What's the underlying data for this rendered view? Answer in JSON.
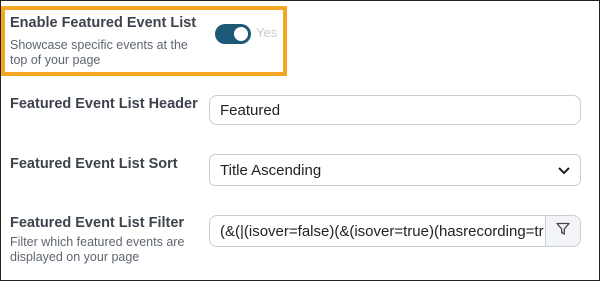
{
  "featured_toggle": {
    "label": "Enable Featured Event List",
    "description": "Showcase specific events at the top of your page",
    "state_text": "Yes",
    "enabled": true
  },
  "header_field": {
    "label": "Featured Event List Header",
    "value": "Featured"
  },
  "sort_field": {
    "label": "Featured Event List Sort",
    "value": "Title Ascending"
  },
  "filter_field": {
    "label": "Featured Event List Filter",
    "description": "Filter which featured events are displayed on your page",
    "value": "(&(|(isover=false)(&(isover=true)(hasrecording=tr"
  },
  "colors": {
    "highlight": "#f5a623",
    "toggle_on": "#1d5a78"
  },
  "icons": {
    "sort_dropdown": "chevron-down-icon",
    "filter_button": "filter-icon"
  }
}
